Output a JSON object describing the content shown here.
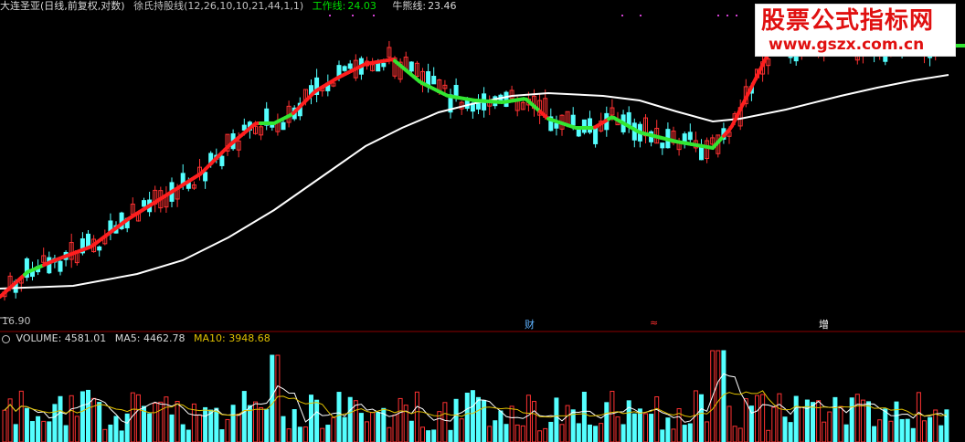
{
  "header": {
    "stock_name": "大连圣亚(日线,前复权,对数)",
    "indicator_name": "徐氏持股线(12,26,10,10,21,44,1,1)",
    "work_line_label": "工作线:",
    "work_line_value": "24.03",
    "bull_line_label": "牛熊线:",
    "bull_line_value": "23.46"
  },
  "price_axis": {
    "low_label": "16.90"
  },
  "events": [
    {
      "text": "财",
      "color": "#5fb3ff"
    },
    {
      "text": "≈",
      "color": "#ff3030"
    },
    {
      "text": "增",
      "color": "#ffffff"
    }
  ],
  "volume_header": {
    "label": "VOLUME: 4581.01",
    "ma5": "MA5: 4462.78",
    "ma10": "MA10: 3948.68"
  },
  "watermark": {
    "title": "股票公式指标网",
    "url": "www.gszx.com.cn"
  },
  "colors": {
    "up": "#ff3232",
    "down": "#54ffff",
    "work_rising": "#ff1e1e",
    "work_falling": "#32e632",
    "bull_bear": "#ffffff",
    "vol_ma5": "#ffffff",
    "vol_ma10": "#e0c000"
  },
  "chart_data": {
    "type": "candlestick",
    "scale": "log",
    "price_min": 16.9,
    "series": [
      {
        "name": "工作线",
        "last": 24.03
      },
      {
        "name": "牛熊线",
        "last": 23.46
      }
    ],
    "volume": {
      "last": 4581.01,
      "ma5": 4462.78,
      "ma10": 3948.68
    }
  }
}
